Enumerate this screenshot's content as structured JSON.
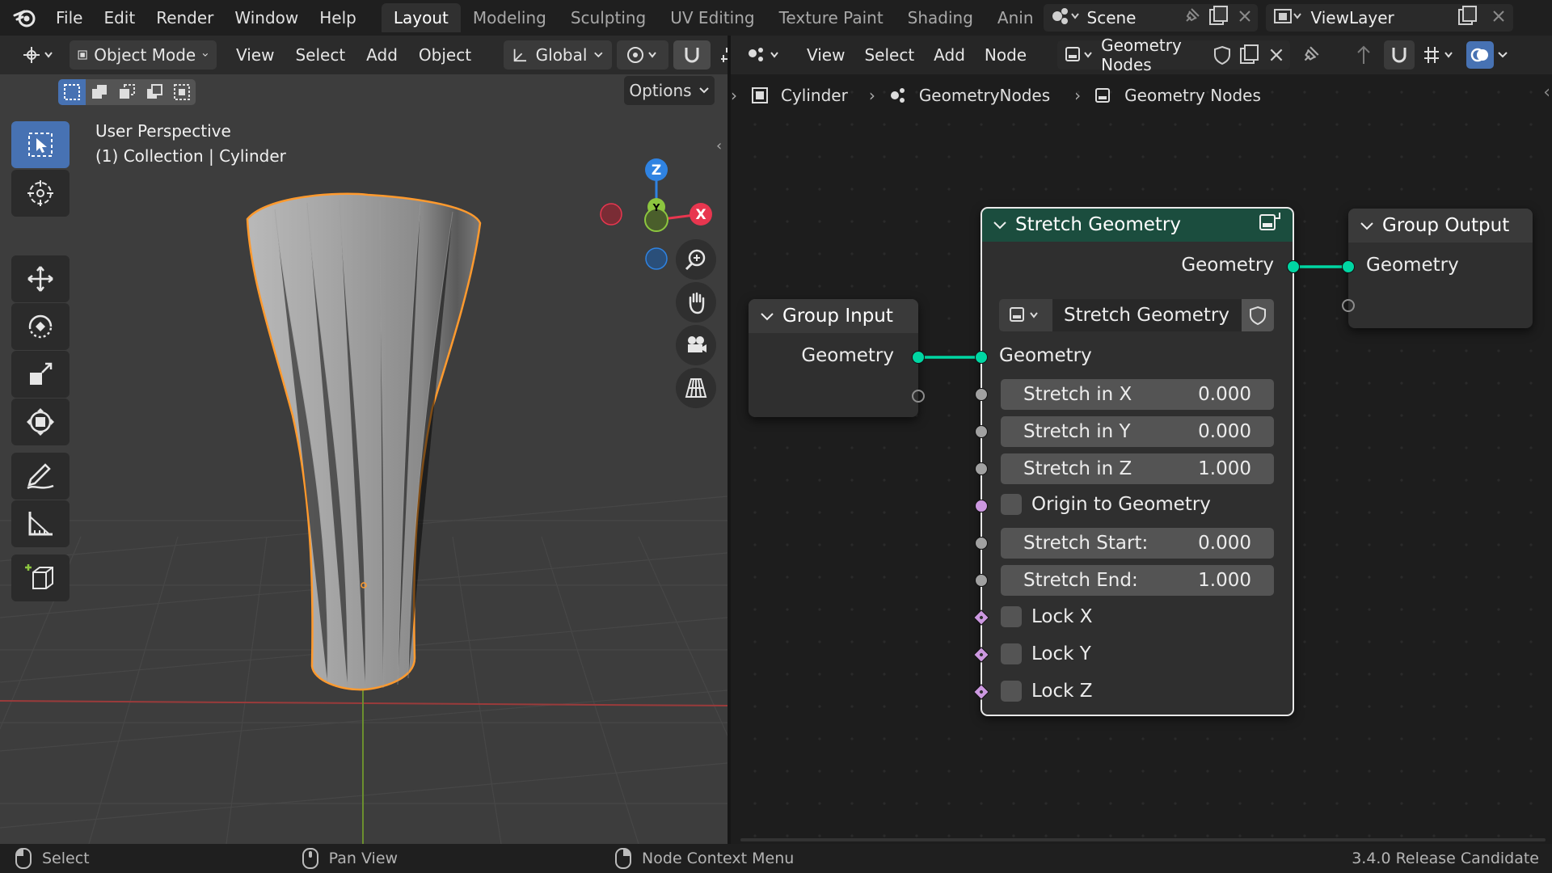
{
  "topbar": {
    "menus": [
      "File",
      "Edit",
      "Render",
      "Window",
      "Help"
    ],
    "workspaces": [
      "Layout",
      "Modeling",
      "Sculpting",
      "UV Editing",
      "Texture Paint",
      "Shading",
      "Anin"
    ],
    "active_workspace": "Layout",
    "scene": "Scene",
    "view_layer": "ViewLayer"
  },
  "viewport": {
    "mode": "Object Mode",
    "menus": [
      "View",
      "Select",
      "Add",
      "Object"
    ],
    "orientation": "Global",
    "options_label": "Options",
    "overlay_line1": "User Perspective",
    "overlay_line2": "(1) Collection | Cylinder",
    "gizmo_axes": {
      "z": "Z",
      "y": "Y",
      "x": "X"
    }
  },
  "node_editor": {
    "menus": [
      "View",
      "Select",
      "Add",
      "Node"
    ],
    "tree_name": "Geometry Nodes",
    "breadcrumb": [
      "Cylinder",
      "GeometryNodes",
      "Geometry Nodes"
    ],
    "nodes": {
      "group_input": {
        "title": "Group Input",
        "output": "Geometry"
      },
      "group_output": {
        "title": "Group Output",
        "input": "Geometry"
      },
      "stretch": {
        "title": "Stretch Geometry",
        "output": "Geometry",
        "group_name": "Stretch Geometry",
        "geometry_input": "Geometry",
        "fields": [
          {
            "label": "Stretch in X",
            "value": "0.000"
          },
          {
            "label": "Stretch in Y",
            "value": "0.000"
          },
          {
            "label": "Stretch in Z",
            "value": "1.000"
          }
        ],
        "origin_label": "Origin to Geometry",
        "fields2": [
          {
            "label": "Stretch Start:",
            "value": "0.000"
          },
          {
            "label": "Stretch End:",
            "value": "1.000"
          }
        ],
        "locks": [
          "Lock X",
          "Lock Y",
          "Lock Z"
        ]
      }
    }
  },
  "statusbar": {
    "select": "Select",
    "pan": "Pan View",
    "context": "Node Context Menu",
    "version": "3.4.0 Release Candidate"
  },
  "colors": {
    "accent": "#4772b3",
    "geometry_socket": "#00d6a3",
    "selection_outline": "#ff9a2e",
    "axis_x": "#e8364f",
    "axis_y": "#8cc63f",
    "axis_z": "#2f83e2"
  },
  "icons": {
    "tools": [
      "select-box-icon",
      "cursor-icon",
      "move-icon",
      "rotate-icon",
      "scale-icon",
      "transform-icon",
      "annotate-icon",
      "measure-icon",
      "add-cube-icon"
    ],
    "nav": [
      "zoom-icon",
      "hand-icon",
      "camera-icon",
      "grid-icon"
    ]
  }
}
